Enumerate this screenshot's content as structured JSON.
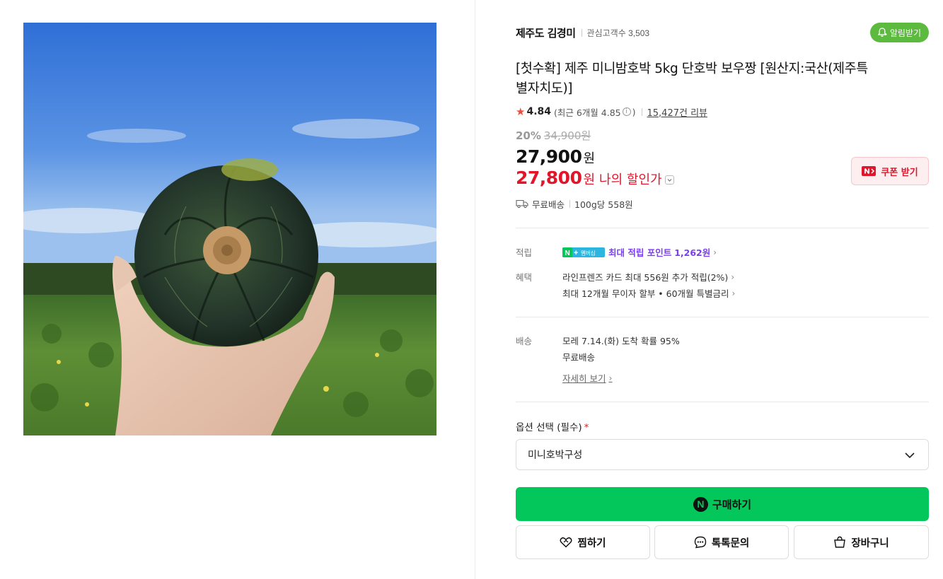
{
  "store": {
    "name": "제주도 김경미",
    "followers_label": "관심고객수",
    "followers_count": "3,503",
    "alert_label": "알림받기"
  },
  "product": {
    "title": "[첫수확] 제주 미니밤호박 5kg 단호박 보우짱 [원산지:국산(제주특별자치도)]",
    "rating": "4.84",
    "recent_rating": "(최근 6개월 4.85",
    "recent_rating_close": ")",
    "review_count": "15,427건 리뷰"
  },
  "price": {
    "discount_rate": "20%",
    "original": "34,900원",
    "sale_number": "27,900",
    "sale_unit": "원",
    "my_number": "27,800",
    "my_unit": "원",
    "my_label": "나의 할인가",
    "coupon_label": "쿠폰 받기"
  },
  "shipping_summary": {
    "fee": "무료배송",
    "unit_price": "100g당 558원"
  },
  "benefits": {
    "points_label": "적립",
    "points_badge": "N+ 멤버십",
    "points_text": "최대 적립 포인트",
    "points_amount": "1,262원",
    "benefit_label": "혜택",
    "benefit_line1": "라인프렌즈 카드 최대 556원 추가 적립(2%)",
    "benefit_line2": "최대 12개월 무이자 할부 • 60개월 특별금리"
  },
  "delivery": {
    "label": "배송",
    "eta": "모레 7.14.(화) 도착 확률 95%",
    "fee": "무료배송",
    "detail_link": "자세히 보기"
  },
  "options": {
    "label": "옵션 선택 (필수)",
    "required_mark": "*",
    "selected": "미니호박구성"
  },
  "actions": {
    "buy": "구매하기",
    "wish": "찜하기",
    "talk": "톡톡문의",
    "cart": "장바구니"
  },
  "colors": {
    "naver_green": "#03c75a",
    "store_green": "#5cba3f",
    "discount_red": "#e2162b",
    "membership_purple": "#7b3ff2"
  },
  "icons": [
    "bell-plus-icon",
    "star-icon",
    "info-icon",
    "chevron-down-icon",
    "truck-icon",
    "chevron-right-icon",
    "naver-n-icon",
    "heart-icon",
    "chat-icon",
    "cart-icon"
  ]
}
